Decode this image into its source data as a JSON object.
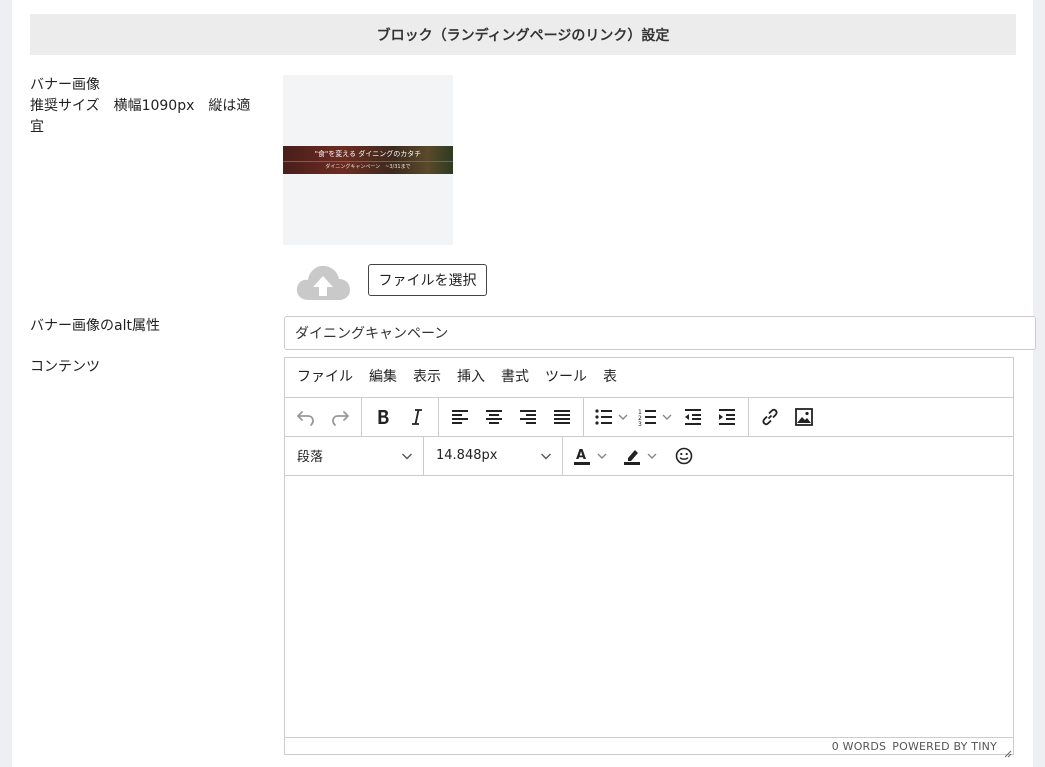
{
  "section": {
    "title": "ブロック（ランディングページのリンク）設定"
  },
  "banner": {
    "label_line1": "バナー画像",
    "label_line2": "推奨サイズ　横幅1090px　縦は適宜",
    "preview_text1": "\"食\"を変える ダイニングのカタチ",
    "preview_text2": "ダイニングキャンペーン　~3/31まで",
    "file_button": "ファイルを選択"
  },
  "alt": {
    "label": "バナー画像のalt属性",
    "value": "ダイニングキャンペーン"
  },
  "contents": {
    "label": "コンテンツ",
    "menu": [
      "ファイル",
      "編集",
      "表示",
      "挿入",
      "書式",
      "ツール",
      "表"
    ],
    "block_format": "段落",
    "font_size": "14.848px",
    "status_words": "0 WORDS",
    "status_powered": "POWERED BY TINY"
  },
  "colors": {
    "accent": "#222222",
    "border": "#cccccc",
    "header_bg": "#ececec"
  }
}
